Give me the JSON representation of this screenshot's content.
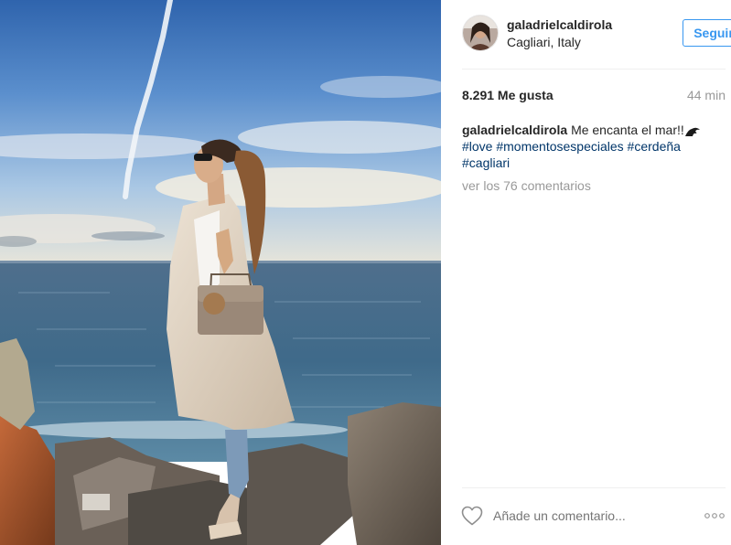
{
  "post": {
    "username": "galadrielcaldirola",
    "location": "Cagliari, Italy",
    "follow_label": "Seguir",
    "likes": "8.291 Me gusta",
    "time_ago": "44 min",
    "caption_text": "Me encanta el mar!!",
    "hashtags": [
      "#love",
      "#momentosespeciales",
      "#cerdeña",
      "#cagliari"
    ],
    "view_comments": "ver los 76 comentarios",
    "comment_placeholder": "Añade un comentario..."
  },
  "icons": {
    "like": "heart-icon",
    "options": "more-options-icon",
    "emoji": "wave-emoji-icon"
  },
  "colors": {
    "accent": "#3897f0",
    "hashtag": "#003569",
    "muted": "#999999",
    "text": "#262626"
  }
}
